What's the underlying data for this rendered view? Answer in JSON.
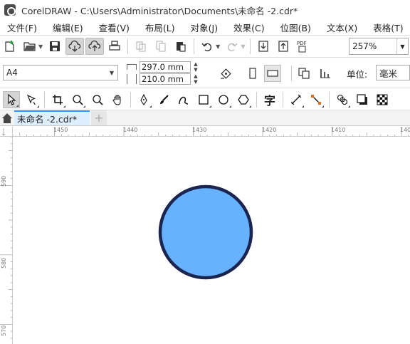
{
  "window": {
    "title": "CorelDRAW - C:\\Users\\Administrator\\Documents\\未命名 -2.cdr*"
  },
  "menubar": {
    "items": [
      {
        "label": "文件(F)"
      },
      {
        "label": "编辑(E)"
      },
      {
        "label": "查看(V)"
      },
      {
        "label": "布局(L)"
      },
      {
        "label": "对象(J)"
      },
      {
        "label": "效果(C)"
      },
      {
        "label": "位图(B)"
      },
      {
        "label": "文本(X)"
      },
      {
        "label": "表格(T)"
      }
    ]
  },
  "toolbar": {
    "zoom_value": "257%",
    "pdf_label": "PDF"
  },
  "property_bar": {
    "page_size": "A4",
    "width_value": "297.0 mm",
    "height_value": "210.0 mm",
    "unit_label": "单位:",
    "unit_value": "毫米"
  },
  "tools": {
    "text_tool_glyph": "字"
  },
  "document_tab": {
    "label": "未命名 -2.cdr*",
    "add_tab_label": "+"
  },
  "rulers": {
    "horizontal_labels": [
      "1450",
      "1440",
      "1430",
      "1420",
      "1410",
      "140"
    ],
    "vertical_labels": [
      "590",
      "580",
      "570"
    ]
  },
  "canvas": {
    "shape": "circle",
    "fill_color": "#66b2ff",
    "stroke_color": "#1a2550"
  }
}
